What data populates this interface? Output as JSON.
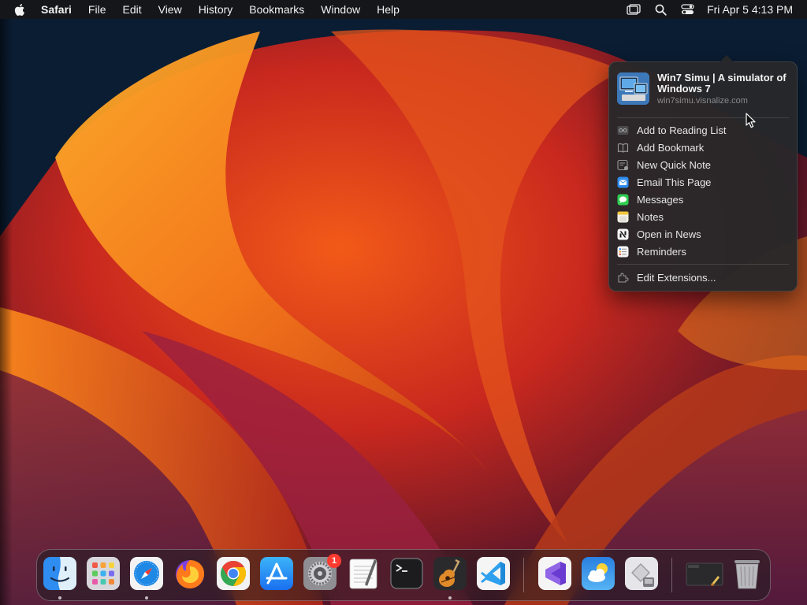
{
  "menubar": {
    "items": [
      "Safari",
      "File",
      "Edit",
      "View",
      "History",
      "Bookmarks",
      "Window",
      "Help"
    ],
    "clock": "Fri Apr 5  4:13 PM"
  },
  "share_popover": {
    "page_title": "Win7 Simu | A simulator of Windows 7",
    "page_url": "win7simu.visnalize.com",
    "items": [
      {
        "label": "Add to Reading List",
        "icon": "glasses-icon"
      },
      {
        "label": "Add Bookmark",
        "icon": "book-icon"
      },
      {
        "label": "New Quick Note",
        "icon": "quick-note-icon"
      },
      {
        "label": "Email This Page",
        "icon": "mail-icon"
      },
      {
        "label": "Messages",
        "icon": "messages-icon"
      },
      {
        "label": "Notes",
        "icon": "notes-icon"
      },
      {
        "label": "Open in News",
        "icon": "news-icon"
      },
      {
        "label": "Reminders",
        "icon": "reminders-icon"
      }
    ],
    "edit_extensions": "Edit Extensions..."
  },
  "dock": {
    "apps": [
      {
        "name": "finder",
        "running": true
      },
      {
        "name": "launchpad",
        "running": false
      },
      {
        "name": "safari",
        "running": true
      },
      {
        "name": "firefox",
        "running": false
      },
      {
        "name": "chrome",
        "running": false
      },
      {
        "name": "app-store",
        "running": false
      },
      {
        "name": "system-settings",
        "running": false,
        "badge": "1"
      },
      {
        "name": "textedit",
        "running": false
      },
      {
        "name": "terminal",
        "running": false
      },
      {
        "name": "garageband",
        "running": true
      },
      {
        "name": "vscode",
        "running": false
      },
      {
        "name": "visual-studio",
        "running": false
      },
      {
        "name": "weather",
        "running": false
      },
      {
        "name": "boot-camp-assistant",
        "running": false
      },
      {
        "name": "screenshot-preview",
        "running": false
      },
      {
        "name": "trash",
        "running": false
      }
    ]
  },
  "colors": {
    "accent_orange": "#f08a1c",
    "wallpaper_red": "#c8281e",
    "wallpaper_magenta": "#6a1c4a",
    "badge_red": "#ff3b30"
  }
}
